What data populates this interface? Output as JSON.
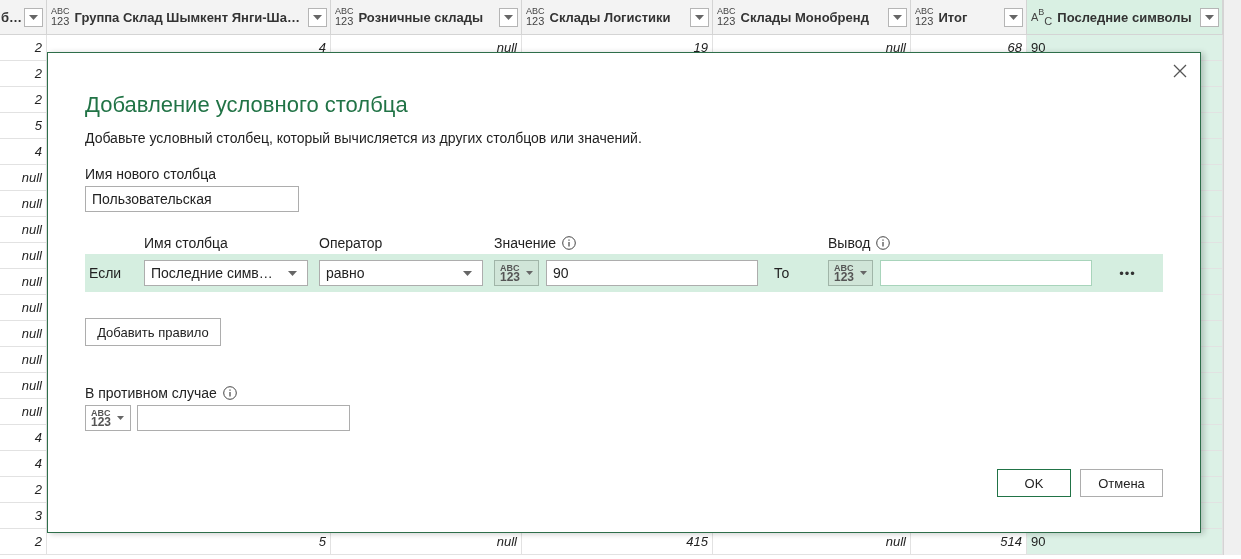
{
  "table": {
    "columns": [
      {
        "label": "б…",
        "selected": false
      },
      {
        "label": "Группа Склад Шымкент Янги-Ша…",
        "type_glyph": [
          "ABC",
          "123"
        ],
        "selected": false
      },
      {
        "label": "Розничные склады",
        "type_glyph": [
          "ABC",
          "123"
        ],
        "selected": false
      },
      {
        "label": "Склады Логистики",
        "type_glyph": [
          "ABC",
          "123"
        ],
        "selected": false
      },
      {
        "label": "Склады Монобренд",
        "type_glyph": [
          "ABC",
          "123"
        ],
        "selected": false
      },
      {
        "label": "Итог",
        "type_glyph": [
          "ABC",
          "123"
        ],
        "selected": false
      },
      {
        "label": "Последние символы",
        "type_glyph": [
          "A",
          "B",
          "C"
        ],
        "selected": true
      }
    ],
    "rows": [
      [
        "2",
        "4",
        "null",
        "19",
        "null",
        "68",
        "90"
      ],
      [
        "2"
      ],
      [
        "2"
      ],
      [
        "5"
      ],
      [
        "4"
      ],
      [
        "null"
      ],
      [
        "null"
      ],
      [
        "null"
      ],
      [
        "null"
      ],
      [
        "null"
      ],
      [
        "null"
      ],
      [
        "null"
      ],
      [
        "null"
      ],
      [
        "null"
      ],
      [
        "null"
      ],
      [
        "4"
      ],
      [
        "4"
      ],
      [
        "2"
      ],
      [
        "3"
      ],
      [
        "2",
        "5",
        "null",
        "415",
        "null",
        "514",
        "90"
      ]
    ]
  },
  "dialog": {
    "title": "Добавление условного столбца",
    "description": "Добавьте условный столбец, который вычисляется из других столбцов или значений.",
    "new_column": {
      "label": "Имя нового столбца",
      "value": "Пользовательская"
    },
    "rule_headers": {
      "column": "Имя столбца",
      "operator": "Оператор",
      "value": "Значение",
      "output": "Вывод"
    },
    "rule": {
      "if_label": "Если",
      "column": "Последние симв…",
      "operator": "равно",
      "value_type": [
        "ABC",
        "123"
      ],
      "value": "90",
      "then_label": "То",
      "output_type": [
        "ABC",
        "123"
      ],
      "more": "•••"
    },
    "add_rule": "Добавить правило",
    "otherwise": {
      "label": "В противном случае",
      "value_type": [
        "ABC",
        "123"
      ]
    },
    "buttons": [
      {
        "label": "OK",
        "kind": "primary"
      },
      {
        "label": "Отмена",
        "kind": "secondary"
      }
    ]
  }
}
